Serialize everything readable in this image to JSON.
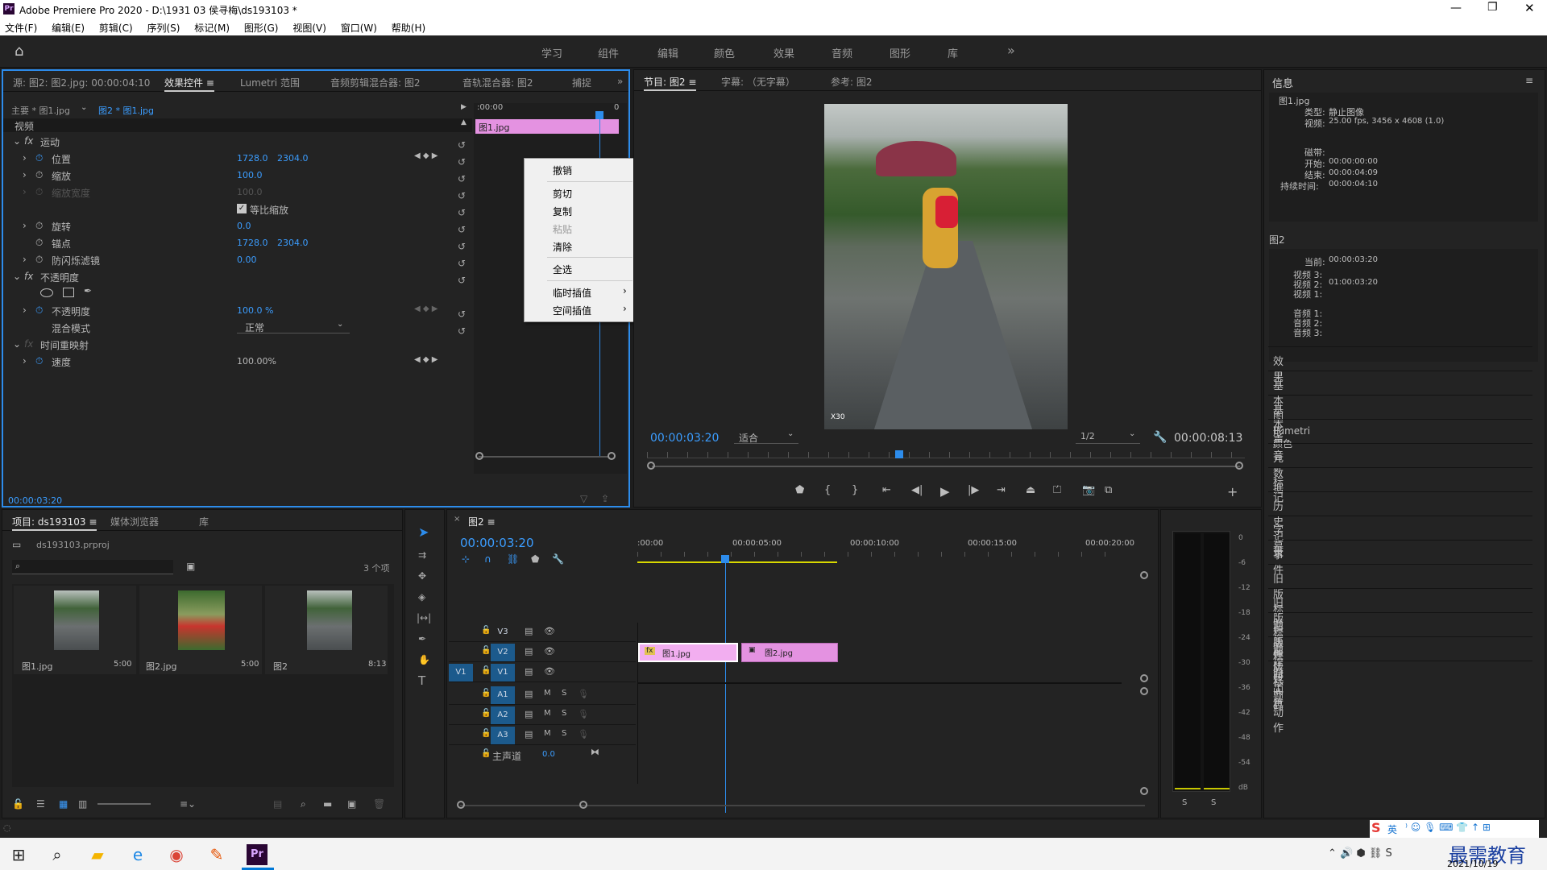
{
  "app": {
    "title": "Adobe Premiere Pro 2020 - D:\\1931 03 侯寻梅\\ds193103 *",
    "logo": "Pr"
  },
  "menu": [
    "文件(F)",
    "编辑(E)",
    "剪辑(C)",
    "序列(S)",
    "标记(M)",
    "图形(G)",
    "视图(V)",
    "窗口(W)",
    "帮助(H)"
  ],
  "workspaces": [
    "学习",
    "组件",
    "编辑",
    "颜色",
    "效果",
    "音频",
    "图形",
    "库"
  ],
  "source_panel": {
    "tabs": [
      "源: 图2: 图2.jpg: 00:00:04:10",
      "效果控件",
      "Lumetri 范围",
      "音频剪辑混合器: 图2",
      "音轨混合器: 图2",
      "捕捉"
    ],
    "master_label": "主要 * 图1.jpg",
    "clip_label": "图2 * 图1.jpg",
    "timecode_start": ":00:00",
    "timecode_end": "0",
    "clip_name": "图1.jpg",
    "section_video": "视频",
    "fx_motion": "运动",
    "props": [
      {
        "name": "位置",
        "v1": "1728.0",
        "v2": "2304.0"
      },
      {
        "name": "缩放",
        "v1": "100.0",
        "v2": ""
      },
      {
        "name": "缩放宽度",
        "v1": "100.0",
        "v2": ""
      },
      {
        "name": "等比缩放",
        "v1": "",
        "v2": ""
      },
      {
        "name": "旋转",
        "v1": "0.0",
        "v2": ""
      },
      {
        "name": "锚点",
        "v1": "1728.0",
        "v2": "2304.0"
      },
      {
        "name": "防闪烁滤镜",
        "v1": "0.00",
        "v2": ""
      }
    ],
    "fx_opacity": "不透明度",
    "opacity_label": "不透明度",
    "opacity_value": "100.0 %",
    "blend_label": "混合模式",
    "blend_value": "正常",
    "fx_time": "时间重映射",
    "speed_label": "速度",
    "speed_value": "100.00%",
    "bottom_timecode": "00:00:03:20"
  },
  "context_menu": [
    "撤销",
    "剪切",
    "复制",
    "粘贴",
    "清除",
    "全选",
    "临时插值",
    "空间插值"
  ],
  "program": {
    "tabs": [
      "节目: 图2",
      "字幕: （无字幕）",
      "参考: 图2"
    ],
    "timecode": "00:00:03:20",
    "fit": "适合",
    "quality": "1/2",
    "duration": "00:00:08:13",
    "watermark": "X30"
  },
  "info_panel": {
    "title": "信息",
    "clip_name": "图1.jpg",
    "rows1": [
      {
        "k": "类型:",
        "v": "静止图像"
      },
      {
        "k": "视频:",
        "v": "25.00 fps, 3456 x 4608 (1.0)"
      },
      {
        "k": "磁带:",
        "v": ""
      },
      {
        "k": "开始:",
        "v": "00:00:00:00"
      },
      {
        "k": "结束:",
        "v": "00:00:04:09"
      },
      {
        "k": "持续时间:",
        "v": "00:00:04:10"
      }
    ],
    "seq_name": "图2",
    "rows2": [
      {
        "k": "当前:",
        "v": "00:00:03:20"
      },
      {
        "k": "视频 3:",
        "v": ""
      },
      {
        "k": "视频 2:",
        "v": "01:00:03:20"
      },
      {
        "k": "视频 1:",
        "v": ""
      },
      {
        "k": "音频 1:",
        "v": ""
      },
      {
        "k": "音频 2:",
        "v": ""
      },
      {
        "k": "音频 3:",
        "v": ""
      }
    ],
    "panels": [
      "效果",
      "基本图形",
      "基本声音",
      "Lumetri 颜色",
      "元数据",
      "标记",
      "历史记录",
      "字幕",
      "事件",
      "旧版标题属性",
      "旧版标题样式",
      "旧版标题工具",
      "旧版标题动作",
      "时间码"
    ]
  },
  "project": {
    "tabs": [
      "项目: ds193103",
      "媒体浏览器",
      "库"
    ],
    "file": "ds193103.prproj",
    "count": "3 个项",
    "items": [
      {
        "name": "图1.jpg",
        "dur": "5:00"
      },
      {
        "name": "图2.jpg",
        "dur": "5:00"
      },
      {
        "name": "图2",
        "dur": "8:13"
      }
    ]
  },
  "timeline": {
    "tab": "图2",
    "timecode": "00:00:03:20",
    "ruler": [
      ":00:00",
      "00:00:05:00",
      "00:00:10:00",
      "00:00:15:00",
      "00:00:20:00"
    ],
    "video_tracks": [
      "V3",
      "V2",
      "V1"
    ],
    "audio_tracks": [
      "A1",
      "A2",
      "A3"
    ],
    "source_patch": "V1",
    "master_label": "主声道",
    "master_value": "0.0",
    "clips": [
      {
        "name": "图1.jpg",
        "track": "V2"
      },
      {
        "name": "图2.jpg",
        "track": "V2"
      }
    ]
  },
  "meter": {
    "scale": [
      "0",
      "-6",
      "-12",
      "-18",
      "-24",
      "-30",
      "-36",
      "-42",
      "-48",
      "-54",
      "dB"
    ],
    "solo": [
      "S",
      "S"
    ]
  },
  "taskbar": {
    "ime": "英",
    "date": "2021/10/19",
    "brand": "最需教育"
  }
}
